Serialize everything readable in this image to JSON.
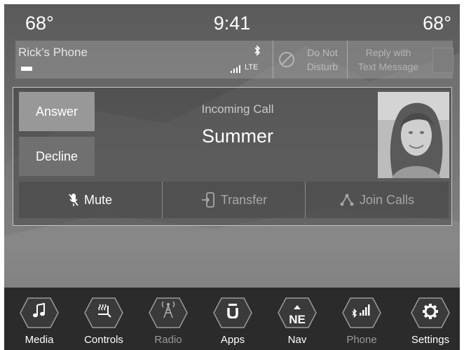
{
  "header": {
    "temp_left": "68°",
    "clock": "9:41",
    "temp_right": "68°"
  },
  "status_bar": {
    "phone_name": "Rick’s Phone",
    "network": "LTE",
    "dnd_label_1": "Do Not",
    "dnd_label_2": "Disturb",
    "reply_label_1": "Reply with",
    "reply_label_2": "Text Message"
  },
  "call": {
    "answer_label": "Answer",
    "decline_label": "Decline",
    "incoming_label": "Incoming Call",
    "caller_name": "Summer",
    "mute_label": "Mute",
    "transfer_label": "Transfer",
    "join_label": "Join Calls"
  },
  "nav": {
    "items": [
      {
        "label": "Media",
        "icon": "music-note-icon"
      },
      {
        "label": "Controls",
        "icon": "seat-controls-icon"
      },
      {
        "label": "Radio",
        "icon": "radio-tower-icon"
      },
      {
        "label": "Apps",
        "icon": "uconnect-apps-icon"
      },
      {
        "label": "Nav",
        "icon": "compass-ne-icon",
        "compass_text": "NE"
      },
      {
        "label": "Phone",
        "icon": "phone-signal-icon"
      },
      {
        "label": "Settings",
        "icon": "gear-icon"
      }
    ]
  }
}
